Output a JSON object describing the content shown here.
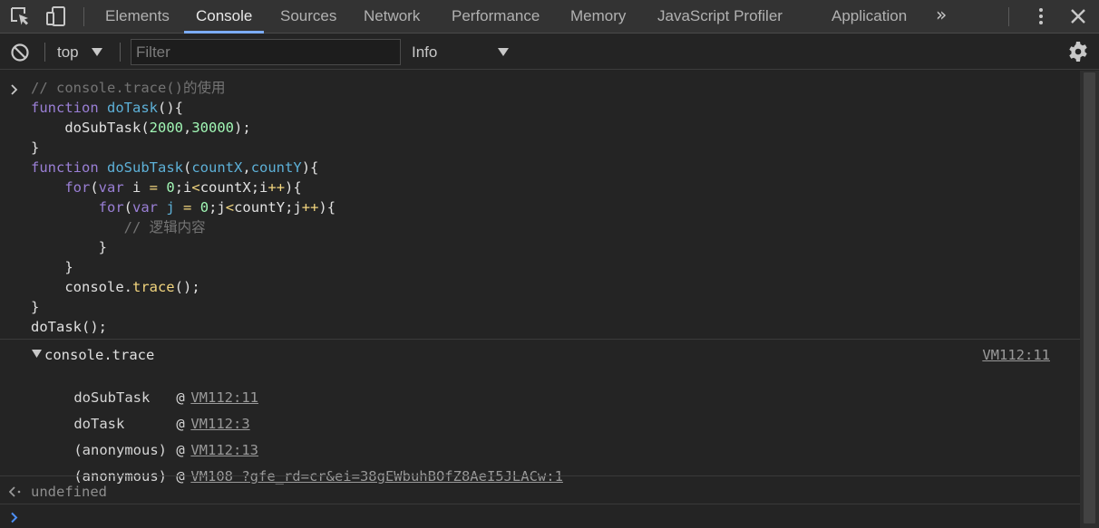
{
  "tabs": {
    "items": [
      "Elements",
      "Console",
      "Sources",
      "Network",
      "Performance",
      "Memory",
      "JavaScript Profiler",
      "Application"
    ],
    "active": "Console",
    "more_label": "»"
  },
  "toolbar": {
    "context": "top",
    "filter_placeholder": "Filter",
    "level": "Info"
  },
  "code": {
    "comment": "// console.trace()的使用",
    "inner_comment": "// 逻辑内容",
    "fn1": "doTask",
    "fn2": "doSubTask",
    "param1": "countX",
    "param2": "countY",
    "num1": "2000",
    "num2": "30000",
    "num_zero": "0",
    "trace_method": "trace",
    "call": "doTask();"
  },
  "trace": {
    "title": "console.trace",
    "source": "VM112:11",
    "frames": [
      {
        "fn": "doSubTask",
        "at": "@",
        "loc": "VM112:11"
      },
      {
        "fn": "doTask",
        "at": "@",
        "loc": "VM112:3"
      },
      {
        "fn": "(anonymous)",
        "at": "@",
        "loc": "VM112:13"
      },
      {
        "fn": "(anonymous)",
        "at": "@",
        "loc": "VM108 ?gfe_rd=cr&ei=38gEWbuhBOfZ8AeI5JLACw:1"
      }
    ]
  },
  "result": {
    "value": "undefined"
  },
  "colors": {
    "background": "#242424",
    "keyword": "#9a7fd5",
    "function": "#5db0d7",
    "number": "#a1f7b5",
    "operator": "#f2d57e",
    "comment": "#747474",
    "active_tab_underline": "#7cacf8"
  },
  "icons": [
    "inspect-element-icon",
    "device-toolbar-icon",
    "more-tabs-icon",
    "kebab-menu-icon",
    "close-icon",
    "clear-console-icon",
    "dropdown-arrow-icon",
    "settings-gear-icon",
    "input-prompt-icon",
    "expand-caret-icon",
    "return-value-icon"
  ]
}
